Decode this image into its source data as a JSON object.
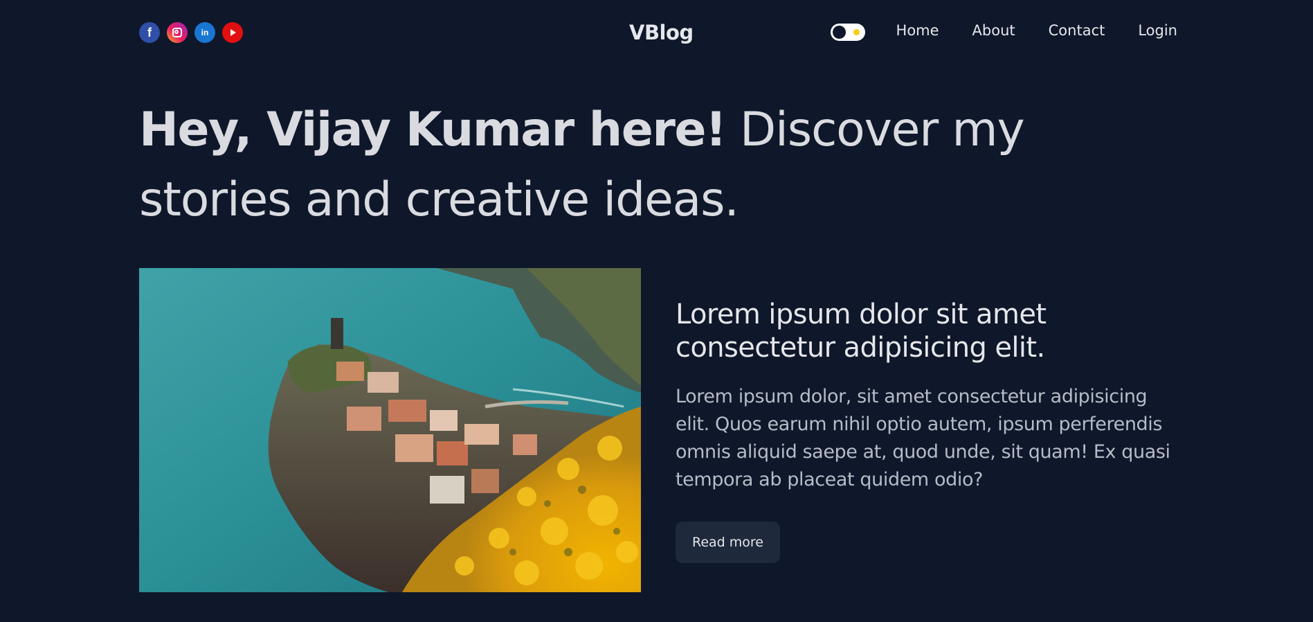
{
  "header": {
    "logo": "VBlog",
    "socials": [
      {
        "icon": "facebook-icon",
        "glyph": "f"
      },
      {
        "icon": "instagram-icon"
      },
      {
        "icon": "linkedin-icon",
        "glyph": "in"
      },
      {
        "icon": "youtube-icon"
      }
    ],
    "nav": {
      "home": "Home",
      "about": "About",
      "contact": "Contact",
      "login": "Login"
    },
    "theme_toggle": {
      "state": "dark",
      "icon": "sun-icon"
    }
  },
  "hero": {
    "bold": "Hey, Vijay Kumar here!",
    "rest": " Discover my stories and creative ideas."
  },
  "post": {
    "title": "Lorem ipsum dolor sit amet consectetur adipisicing elit.",
    "excerpt": "Lorem ipsum dolor, sit amet consectetur adipisicing elit. Quos earum nihil optio autem, ipsum perferendis omnis aliquid saepe at, quod unde, sit quam! Ex quasi tempora ab placeat quidem odio?",
    "button_label": "Read more"
  },
  "colors": {
    "background": "#0f172a",
    "button": "#1e293b",
    "text": "#e5e7eb",
    "muted": "#b6bcc7",
    "toggle_sun": "#facc15"
  }
}
